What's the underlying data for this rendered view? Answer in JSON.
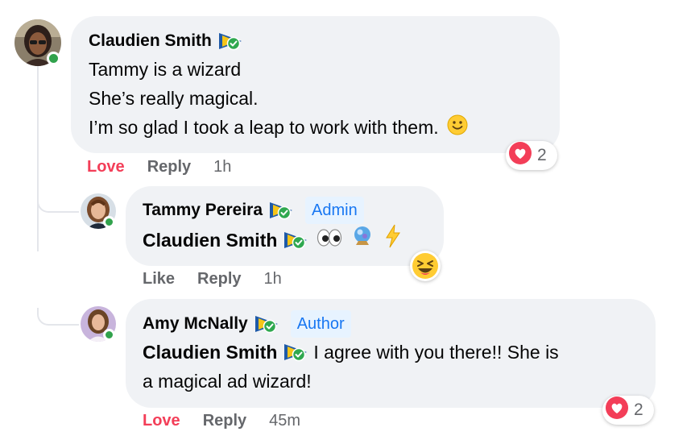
{
  "comments": [
    {
      "author": "Claudien Smith",
      "lines": [
        "Tammy is a wizard",
        "She’s really magical.",
        "I’m so glad I took a leap to work with them."
      ],
      "actions": {
        "react_label": "Love",
        "reply_label": "Reply",
        "time": "1h"
      },
      "reaction": {
        "type": "heart",
        "count": "2"
      }
    },
    {
      "author": "Tammy Pereira",
      "role": "Admin",
      "mention": "Claudien Smith",
      "actions": {
        "react_label": "Like",
        "reply_label": "Reply",
        "time": "1h"
      },
      "reaction": {
        "type": "laughing"
      }
    },
    {
      "author": "Amy McNally",
      "role": "Author",
      "mention": "Claudien Smith",
      "text_part1": "I agree with you there!! She is",
      "text_part2": "a magical ad wizard!",
      "actions": {
        "react_label": "Love",
        "reply_label": "Reply",
        "time": "45m"
      },
      "reaction": {
        "type": "heart",
        "count": "2"
      }
    }
  ],
  "icons": {
    "verified": "verified-badge-icon",
    "smile": "smiling-face-icon",
    "eyes": "eyes-icon",
    "crystal_ball": "crystal-ball-icon",
    "lightning": "lightning-icon",
    "heart": "heart-reaction-icon",
    "laughing": "laughing-face-icon"
  },
  "colors": {
    "bubble": "#f0f2f5",
    "love": "#f33e58",
    "badge_bg": "#e7f3ff",
    "badge_text": "#1877f2",
    "online": "#31a24c",
    "meta": "#65676b"
  }
}
